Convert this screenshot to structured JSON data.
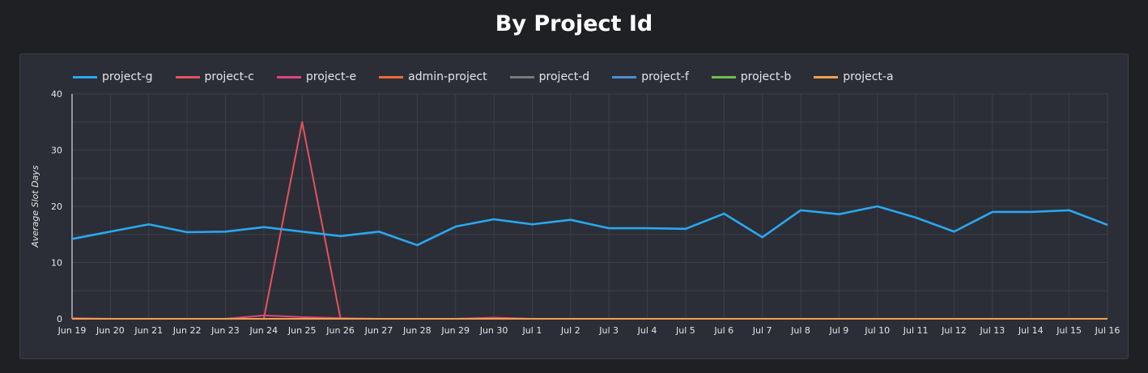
{
  "title": "By Project Id",
  "chart_data": {
    "type": "line",
    "title": "By Project Id",
    "xlabel": "",
    "ylabel": "Average Slot Days",
    "ylim": [
      0,
      40
    ],
    "yticks": [
      0,
      10,
      20,
      30,
      40
    ],
    "grid": true,
    "legend_position": "top-left",
    "x": [
      "Jun 19",
      "Jun 20",
      "Jun 21",
      "Jun 22",
      "Jun 23",
      "Jun 24",
      "Jun 25",
      "Jun 26",
      "Jun 27",
      "Jun 28",
      "Jun 29",
      "Jun 30",
      "Jul 1",
      "Jul 2",
      "Jul 3",
      "Jul 4",
      "Jul 5",
      "Jul 6",
      "Jul 7",
      "Jul 8",
      "Jul 9",
      "Jul 10",
      "Jul 11",
      "Jul 12",
      "Jul 13",
      "Jul 14",
      "Jul 15",
      "Jul 16"
    ],
    "series": [
      {
        "name": "project-g",
        "color": "#29a8ef",
        "values": [
          14.2,
          15.5,
          16.8,
          15.4,
          15.5,
          16.3,
          15.5,
          14.7,
          15.5,
          13.1,
          16.4,
          17.7,
          16.8,
          17.6,
          16.1,
          16.1,
          16.0,
          18.7,
          14.5,
          19.3,
          18.6,
          20.0,
          18.0,
          15.5,
          19.0,
          19.0,
          19.3,
          16.7
        ]
      },
      {
        "name": "project-c",
        "color": "#e5525b",
        "values": [
          0,
          0,
          0,
          0,
          0,
          0,
          35,
          0,
          0,
          0,
          0,
          0,
          0,
          0,
          0,
          0,
          0,
          0,
          0,
          0,
          0,
          0,
          0,
          0,
          0,
          0,
          0,
          0
        ]
      },
      {
        "name": "project-e",
        "color": "#e0457b",
        "values": [
          0.1,
          0,
          0,
          0,
          0,
          0.6,
          0.3,
          0.1,
          0,
          0,
          0,
          0.2,
          0,
          0,
          0,
          0,
          0,
          0,
          0,
          0,
          0,
          0,
          0,
          0,
          0,
          0,
          0,
          0
        ]
      },
      {
        "name": "admin-project",
        "color": "#f06a35",
        "values": [
          0,
          0,
          0,
          0,
          0,
          0,
          0,
          0,
          0,
          0,
          0,
          0,
          0,
          0,
          0,
          0,
          0,
          0,
          0,
          0,
          0,
          0,
          0,
          0,
          0,
          0,
          0,
          0
        ]
      },
      {
        "name": "project-d",
        "color": "#7a7a7a",
        "values": [
          0,
          0,
          0,
          0,
          0,
          0,
          0,
          0,
          0,
          0,
          0,
          0,
          0,
          0,
          0,
          0,
          0,
          0,
          0,
          0,
          0,
          0,
          0,
          0,
          0,
          0,
          0,
          0
        ]
      },
      {
        "name": "project-f",
        "color": "#4a8fd0",
        "values": [
          0,
          0,
          0,
          0,
          0,
          0,
          0,
          0,
          0,
          0,
          0,
          0,
          0,
          0,
          0,
          0,
          0,
          0,
          0,
          0,
          0,
          0,
          0,
          0,
          0,
          0,
          0,
          0
        ]
      },
      {
        "name": "project-b",
        "color": "#6cc04a",
        "values": [
          0,
          0,
          0,
          0,
          0,
          0,
          0,
          0,
          0,
          0,
          0,
          0,
          0,
          0,
          0,
          0,
          0,
          0,
          0,
          0,
          0,
          0,
          0,
          0,
          0,
          0,
          0,
          0
        ]
      },
      {
        "name": "project-a",
        "color": "#f2a04a",
        "values": [
          0,
          0,
          0,
          0,
          0,
          0,
          0,
          0,
          0,
          0,
          0,
          0,
          0,
          0,
          0,
          0,
          0,
          0,
          0,
          0,
          0,
          0,
          0,
          0,
          0,
          0,
          0,
          0
        ]
      }
    ]
  }
}
